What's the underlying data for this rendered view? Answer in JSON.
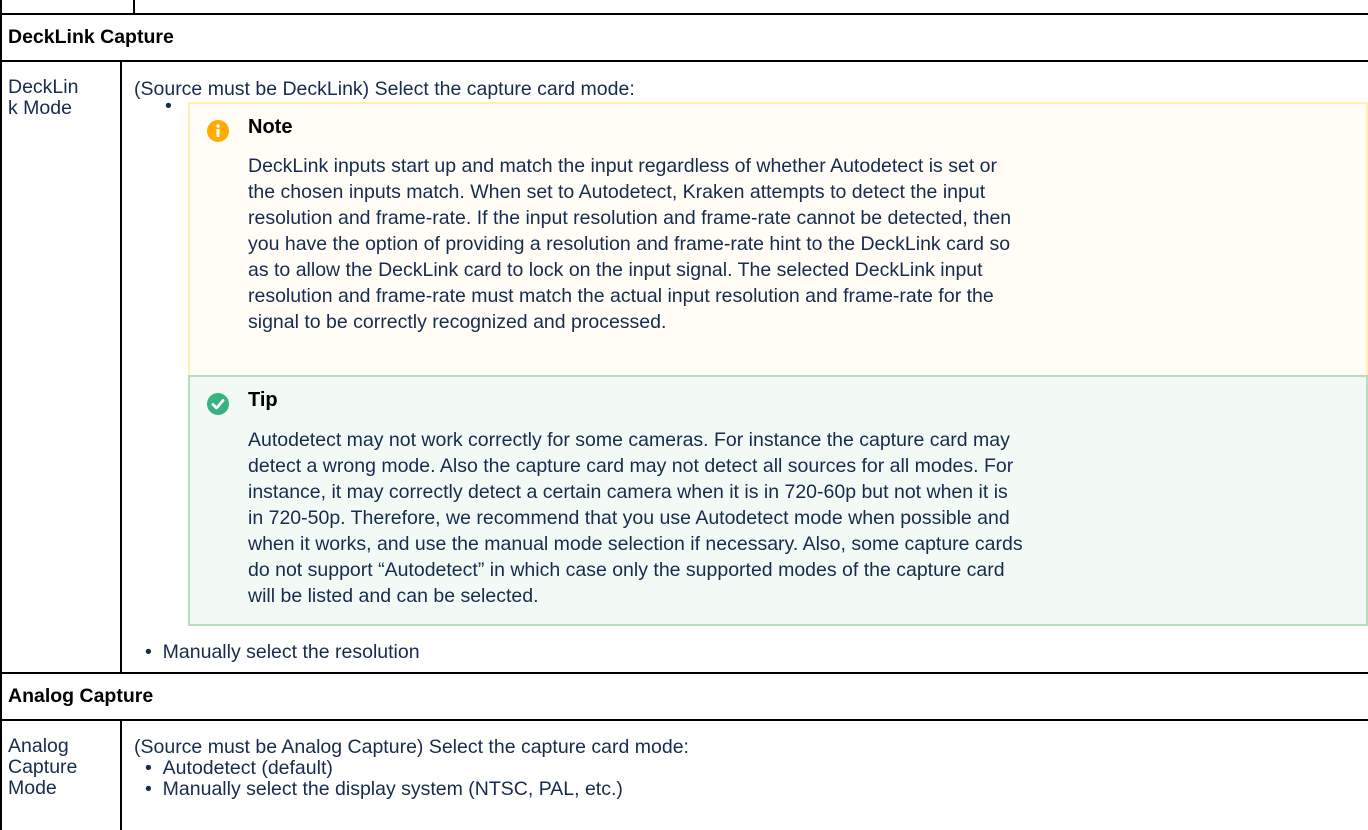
{
  "sections": [
    {
      "title": "DeckLink Capture",
      "rows": [
        {
          "parameter_line1": "DeckLin",
          "parameter_line2": "k Mode",
          "intro": "(Source must be DeckLink) Select the capture card mode:",
          "note": {
            "title": "Note",
            "icon": "info-icon",
            "color": "#ffab00",
            "lines": [
              "DeckLink inputs start up and match the input regardless of whether Autodetect is set or",
              "the chosen inputs match. When set to Autodetect, Kraken attempts to detect the input",
              "resolution and frame-rate. If the input resolution and frame-rate cannot be detected, then",
              "you have the option of providing a resolution and frame-rate hint to the DeckLink card so",
              "as to allow the DeckLink card to lock on the input signal. The selected DeckLink input",
              "resolution and frame-rate must match the actual input resolution and frame-rate for the",
              "signal to be correctly recognized and processed."
            ]
          },
          "tip": {
            "title": "Tip",
            "icon": "check-circle-icon",
            "color": "#36b37e",
            "lines": [
              "Autodetect may not work correctly for some cameras. For instance the capture card may",
              "detect a wrong mode. Also the capture card may not detect all sources for all modes. For",
              "instance, it may correctly detect a certain camera when it is in 720-60p but not when it is",
              "in 720-50p. Therefore, we recommend that you use Autodetect mode when possible and",
              "when it works, and use the manual mode selection if necessary. Also, some capture cards",
              "do not support “Autodetect” in which case only the supported modes of the capture card",
              "will be listed and can be selected."
            ]
          },
          "bullets": [
            "Manually select the resolution"
          ]
        }
      ]
    },
    {
      "title": "Analog Capture",
      "rows": [
        {
          "parameter_line1": "Analog",
          "parameter_line2": "Capture",
          "parameter_line3": "Mode",
          "intro": "(Source must be Analog Capture) Select the capture card mode:",
          "bullets": [
            "Autodetect (default)",
            "Manually select the display system (NTSC, PAL, etc.)"
          ]
        }
      ]
    }
  ]
}
